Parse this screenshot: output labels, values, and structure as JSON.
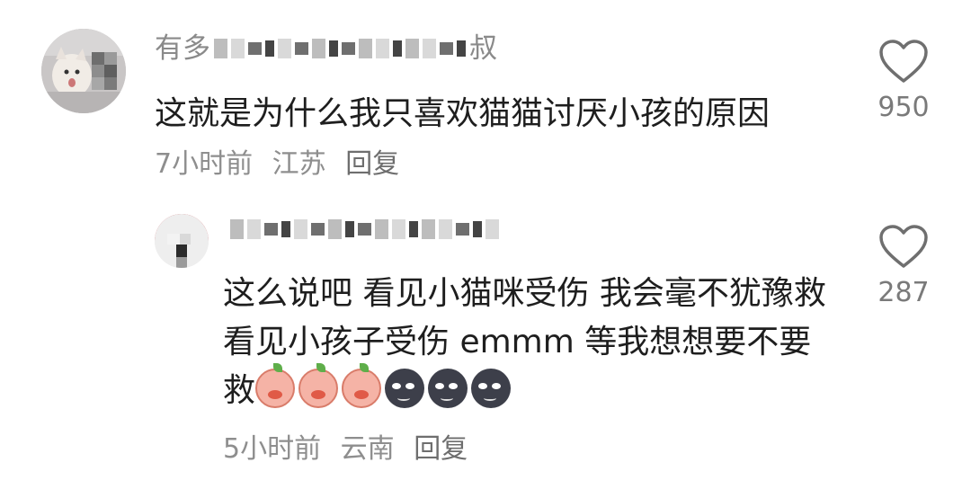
{
  "colors": {
    "primary_text": "#1e1e1e",
    "secondary_text": "#8e8e8e",
    "background": "#ffffff"
  },
  "comment": {
    "username_start": "有多",
    "username_end": "叔",
    "text": "这就是为什么我只喜欢猫猫讨厌小孩的原因",
    "time": "7小时前",
    "location": "江苏",
    "reply_label": "回复",
    "like_icon": "heart-outline-icon",
    "likes": "950"
  },
  "reply": {
    "text": "这么说吧 看见小猫咪受伤 我会毫不犹豫救 看见小孩子受伤 emmm 等我想想要不要救",
    "emojis": [
      "peach-face-emoji",
      "peach-face-emoji",
      "peach-face-emoji",
      "dark-moon-face-emoji",
      "dark-moon-face-emoji",
      "dark-moon-face-emoji"
    ],
    "time": "5小时前",
    "location": "云南",
    "reply_label": "回复",
    "like_icon": "heart-outline-icon",
    "likes": "287"
  }
}
